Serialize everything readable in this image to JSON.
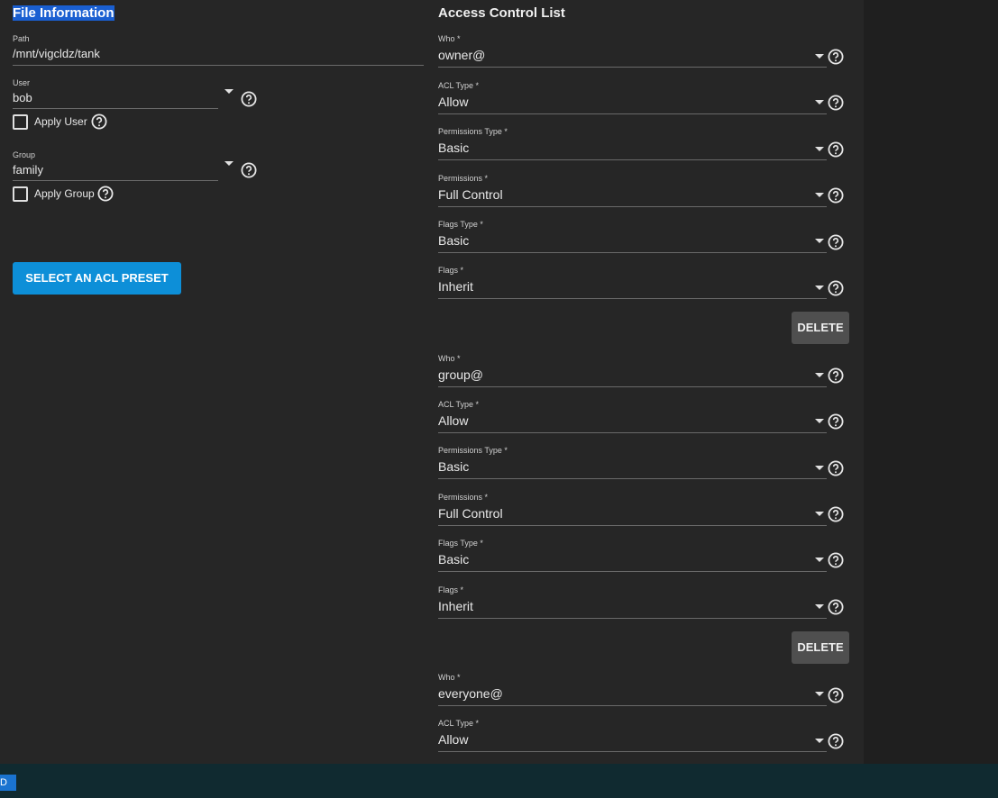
{
  "file_info": {
    "title": "File Information",
    "path": {
      "label": "Path",
      "value": "/mnt/vigcldz/tank"
    },
    "user": {
      "label": "User",
      "value": "bob",
      "apply_label": "Apply User"
    },
    "group": {
      "label": "Group",
      "value": "family",
      "apply_label": "Apply Group"
    },
    "preset_button": "SELECT AN ACL PRESET"
  },
  "acl": {
    "title": "Access Control List",
    "delete_label": "DELETE",
    "entries": [
      {
        "who_label": "Who *",
        "who": "owner@",
        "acl_type_label": "ACL Type *",
        "acl_type": "Allow",
        "perm_type_label": "Permissions Type *",
        "perm_type": "Basic",
        "perms_label": "Permissions *",
        "perms": "Full Control",
        "flags_type_label": "Flags Type *",
        "flags_type": "Basic",
        "flags_label": "Flags *",
        "flags": "Inherit"
      },
      {
        "who_label": "Who *",
        "who": "group@",
        "acl_type_label": "ACL Type *",
        "acl_type": "Allow",
        "perm_type_label": "Permissions Type *",
        "perm_type": "Basic",
        "perms_label": "Permissions *",
        "perms": "Full Control",
        "flags_type_label": "Flags Type *",
        "flags_type": "Basic",
        "flags_label": "Flags *",
        "flags": "Inherit"
      },
      {
        "who_label": "Who *",
        "who": "everyone@",
        "acl_type_label": "ACL Type *",
        "acl_type": "Allow"
      }
    ]
  },
  "taskbar": {
    "icon_text": "D"
  },
  "icons": {
    "help": "help-circle-icon",
    "dropdown": "caret-down-icon"
  },
  "colors": {
    "accent": "#0d8fd8",
    "background": "#262626",
    "selection": "#1a5fd1"
  }
}
